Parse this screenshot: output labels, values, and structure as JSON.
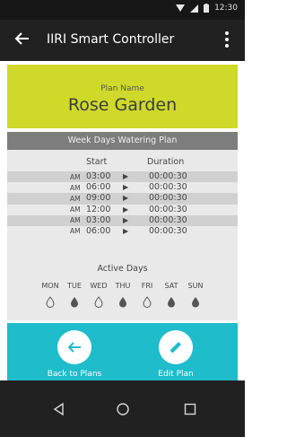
{
  "status_bar": {
    "time": "12:30",
    "icons": [
      "wifi-icon",
      "signal-icon",
      "battery-icon"
    ]
  },
  "app_bar": {
    "title": "IIRI Smart Controller",
    "back_icon": "arrow-left-icon",
    "menu_icon": "more-vert-icon"
  },
  "plan": {
    "label": "Plan Name",
    "name": "Rose Garden",
    "header_color": "#cfd92a"
  },
  "schedule": {
    "section_title": "Week Days Watering Plan",
    "columns": {
      "start": "Start",
      "duration": "Duration"
    },
    "rows": [
      {
        "ampm": "AM",
        "time": "03:00",
        "duration": "00:00:30"
      },
      {
        "ampm": "AM",
        "time": "06:00",
        "duration": "00:00:30"
      },
      {
        "ampm": "AM",
        "time": "09:00",
        "duration": "00:00:30"
      },
      {
        "ampm": "AM",
        "time": "12:00",
        "duration": "00:00:30"
      },
      {
        "ampm": "AM",
        "time": "03:00",
        "duration": "00:00:30"
      },
      {
        "ampm": "AM",
        "time": "06:00",
        "duration": "00:00:30"
      }
    ]
  },
  "active_days": {
    "title": "Active Days",
    "days": [
      {
        "name": "MON",
        "active": false
      },
      {
        "name": "TUE",
        "active": true
      },
      {
        "name": "WED",
        "active": false
      },
      {
        "name": "THU",
        "active": true
      },
      {
        "name": "FRI",
        "active": false
      },
      {
        "name": "SAT",
        "active": true
      },
      {
        "name": "SUN",
        "active": true
      }
    ]
  },
  "actions": {
    "back": {
      "label": "Back to Plans",
      "icon": "arrow-left-icon"
    },
    "edit": {
      "label": "Edit Plan",
      "icon": "pencil-icon"
    },
    "panel_color": "#1fbccb"
  },
  "nav": {
    "back_icon": "nav-back-icon",
    "home_icon": "nav-home-icon",
    "recents_icon": "nav-recents-icon"
  }
}
